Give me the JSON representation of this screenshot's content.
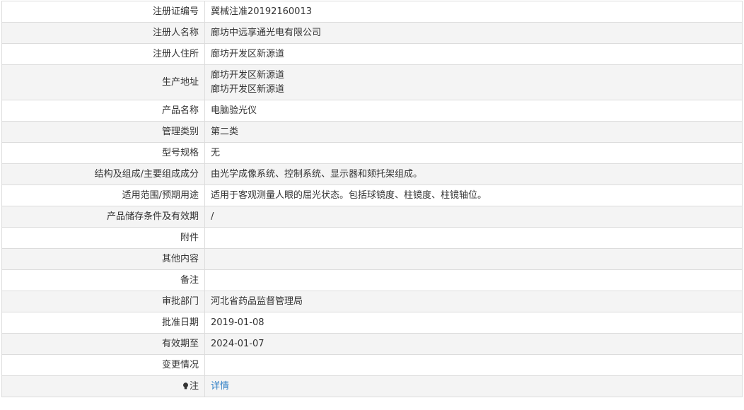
{
  "rows": [
    {
      "label": "注册证编号",
      "value": "冀械注准20192160013"
    },
    {
      "label": "注册人名称",
      "value": "廊坊中远享通光电有限公司"
    },
    {
      "label": "注册人住所",
      "value": "廊坊开发区新源道"
    },
    {
      "label": "生产地址",
      "value_lines": [
        "廊坊开发区新源道",
        "廊坊开发区新源道"
      ]
    },
    {
      "label": "产品名称",
      "value": "电脑验光仪"
    },
    {
      "label": "管理类别",
      "value": "第二类"
    },
    {
      "label": "型号规格",
      "value": "无"
    },
    {
      "label": "结构及组成/主要组成成分",
      "value": "由光学成像系统、控制系统、显示器和颏托架组成。"
    },
    {
      "label": "适用范围/预期用途",
      "value": "适用于客观测量人眼的屈光状态。包括球镜度、柱镜度、柱镜轴位。"
    },
    {
      "label": "产品储存条件及有效期",
      "value": "/"
    },
    {
      "label": "附件",
      "value": ""
    },
    {
      "label": "其他内容",
      "value": ""
    },
    {
      "label": "备注",
      "value": ""
    },
    {
      "label": "审批部门",
      "value": "河北省药品监督管理局"
    },
    {
      "label": "批准日期",
      "value": "2019-01-08"
    },
    {
      "label": "有效期至",
      "value": "2024-01-07"
    },
    {
      "label": "变更情况",
      "value": ""
    },
    {
      "label": "注",
      "icon": "lightbulb-icon",
      "link_text": "详情"
    }
  ],
  "colors": {
    "link": "#2f7fc6",
    "border": "#dcdcdc",
    "stripe": "#f4f4f4"
  }
}
